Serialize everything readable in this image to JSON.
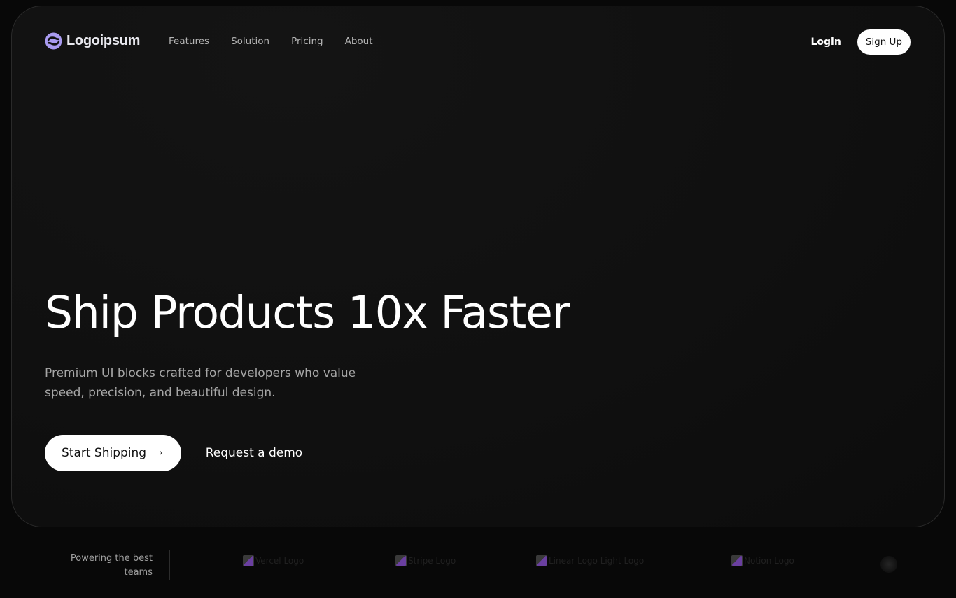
{
  "brand": {
    "name": "Logoipsum",
    "logo_icon": "logo-swirl-icon",
    "accent": "#a99bf0"
  },
  "nav": {
    "links": [
      "Features",
      "Solution",
      "Pricing",
      "About"
    ],
    "login": "Login",
    "signup": "Sign Up"
  },
  "hero": {
    "headline": "Ship Products 10x Faster",
    "subtitle": "Premium UI blocks crafted for developers who value speed, precision, and beautiful design.",
    "primary_cta": "Start Shipping",
    "primary_cta_icon": "chevron-right-icon",
    "secondary_cta": "Request a demo"
  },
  "partners": {
    "tagline": "Powering the best teams",
    "logos": [
      {
        "alt": "Vercel Logo"
      },
      {
        "alt": "Stripe Logo"
      },
      {
        "alt": "Linear Logo Light Logo"
      },
      {
        "alt": "Notion Logo"
      }
    ]
  },
  "colors": {
    "page_bg": "#080808",
    "card_bg": "#101010",
    "card_border": "#2a2a2a",
    "text_primary": "#ffffff",
    "text_muted": "#a6a6a6"
  }
}
